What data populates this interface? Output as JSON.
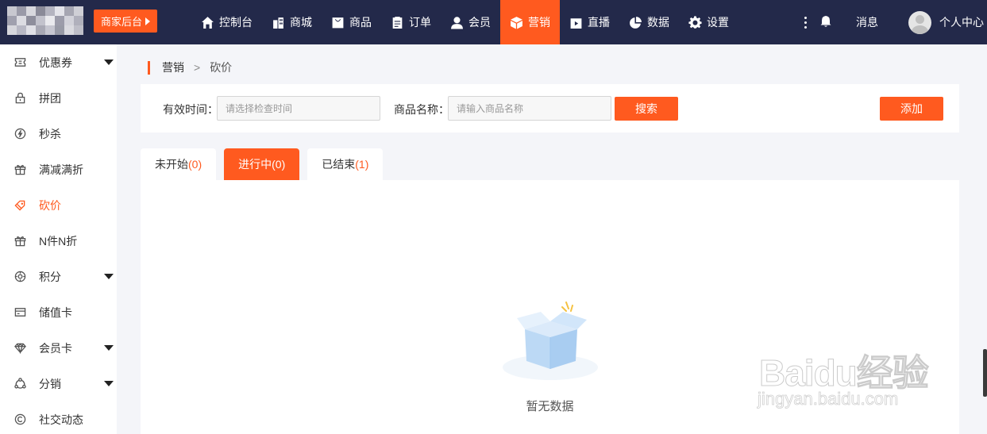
{
  "header": {
    "merchant_button": "商家后台",
    "nav": [
      {
        "label": "控制台",
        "icon": "home-icon"
      },
      {
        "label": "商城",
        "icon": "building-icon"
      },
      {
        "label": "商品",
        "icon": "bag-icon"
      },
      {
        "label": "订单",
        "icon": "clipboard-icon"
      },
      {
        "label": "会员",
        "icon": "user-icon"
      },
      {
        "label": "营销",
        "icon": "cube-icon",
        "active": true
      },
      {
        "label": "直播",
        "icon": "tv-icon"
      },
      {
        "label": "数据",
        "icon": "pie-icon"
      },
      {
        "label": "设置",
        "icon": "gear-icon"
      }
    ],
    "messages": "消息",
    "user_center": "个人中心"
  },
  "sidebar": {
    "items": [
      {
        "label": "优惠券",
        "icon": "ticket-icon",
        "expandable": true
      },
      {
        "label": "拼团",
        "icon": "lock-icon"
      },
      {
        "label": "秒杀",
        "icon": "bolt-icon"
      },
      {
        "label": "满减满折",
        "icon": "gift-icon"
      },
      {
        "label": "砍价",
        "icon": "tag-icon",
        "active": true
      },
      {
        "label": "N件N折",
        "icon": "gift-icon"
      },
      {
        "label": "积分",
        "icon": "target-icon",
        "expandable": true
      },
      {
        "label": "储值卡",
        "icon": "card-icon"
      },
      {
        "label": "会员卡",
        "icon": "diamond-icon",
        "expandable": true
      },
      {
        "label": "分销",
        "icon": "share-icon",
        "expandable": true
      },
      {
        "label": "社交动态",
        "icon": "copyright-icon"
      }
    ]
  },
  "breadcrumb": {
    "parent": "营销",
    "separator": ">",
    "current": "砍价"
  },
  "filter": {
    "time_label": "有效时间：",
    "time_placeholder": "请选择检查时间",
    "name_label": "商品名称：",
    "name_placeholder": "请输入商品名称",
    "search_button": "搜索",
    "add_button": "添加"
  },
  "tabs": [
    {
      "label": "未开始",
      "count": "(0)"
    },
    {
      "label": "进行中",
      "count": "(0)",
      "active": true
    },
    {
      "label": "已结束",
      "count": "(1)"
    }
  ],
  "empty": {
    "text": "暂无数据"
  },
  "watermark": {
    "logo": "Baidu经验",
    "url": "jingyan.baidu.com"
  },
  "colors": {
    "accent": "#ff5a1f",
    "topbar": "#23294a",
    "background": "#f4f5f9"
  }
}
